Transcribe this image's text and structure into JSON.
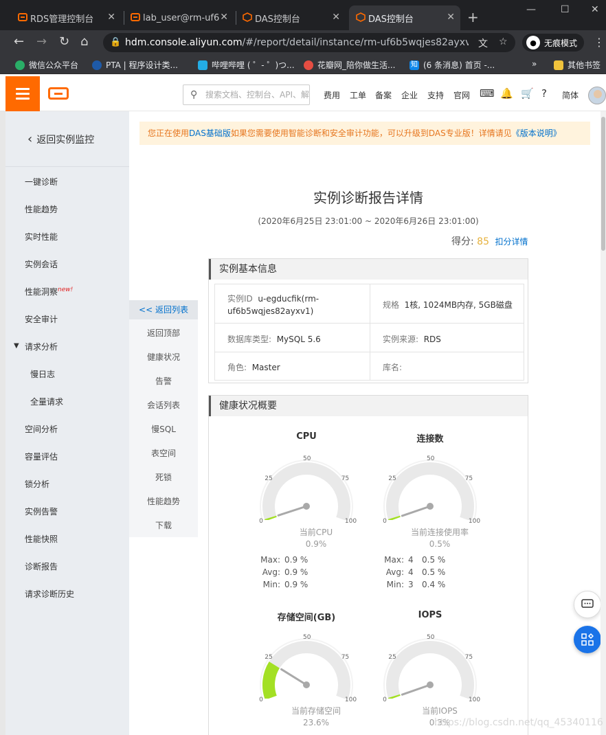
{
  "browser": {
    "tabs": [
      {
        "title": "RDS管理控制台"
      },
      {
        "title": "lab_user@rm-uf6"
      },
      {
        "title": "DAS控制台"
      },
      {
        "title": "DAS控制台"
      }
    ],
    "url_host": "hdm.console.aliyun.com",
    "url_path": "/#/report/detail/instance/rm-uf6b5wqjes82ayxv...",
    "incognito_label": "无痕模式",
    "bookmarks": [
      {
        "label": "微信公众平台"
      },
      {
        "label": "PTA | 程序设计类..."
      },
      {
        "label": "哔哩哔哩 ( ゜- ゜)つ..."
      },
      {
        "label": "花瓣网_陪你做生活..."
      },
      {
        "label": "(6 条消息) 首页 -..."
      }
    ],
    "other_bookmarks": "其他书签"
  },
  "topnav": {
    "search_placeholder": "搜索文档、控制台、API、解",
    "items": [
      "费用",
      "工单",
      "备案",
      "企业",
      "支持",
      "官网"
    ],
    "lang": "简体"
  },
  "sidebar": {
    "back_label": "返回实例监控",
    "items": [
      {
        "label": "一键诊断"
      },
      {
        "label": "性能趋势"
      },
      {
        "label": "实时性能"
      },
      {
        "label": "实例会话"
      },
      {
        "label": "性能洞察",
        "badge": "new!"
      },
      {
        "label": "安全审计"
      },
      {
        "label": "请求分析"
      },
      {
        "label": "慢日志"
      },
      {
        "label": "全量请求"
      },
      {
        "label": "空间分析"
      },
      {
        "label": "容量评估"
      },
      {
        "label": "锁分析"
      },
      {
        "label": "实例告警"
      },
      {
        "label": "性能快照"
      },
      {
        "label": "诊断报告"
      },
      {
        "label": "请求诊断历史"
      }
    ]
  },
  "anchor_nav": {
    "items": [
      "<< 返回列表",
      "返回顶部",
      "健康状况",
      "告警",
      "会话列表",
      "慢SQL",
      "表空间",
      "死锁",
      "性能趋势",
      "下载"
    ]
  },
  "notice": {
    "prefix": "您正在使用",
    "basic": "DAS基础版",
    "middle": "如果您需要使用智能诊断和安全审计功能，可以升级到DAS专业版！详情请见",
    "doc": "《版本说明》"
  },
  "report": {
    "title": "实例诊断报告详情",
    "range": "(2020年6月25日 23:01:00 ~ 2020年6月26日 23:01:00)",
    "score_label": "得分:",
    "score_value": "85",
    "score_detail": "扣分详情"
  },
  "instance_info": {
    "heading": "实例基本信息",
    "id_key": "实例ID",
    "id_val_1": "u-egducfik(rm-",
    "id_val_2": "uf6b5wqjes82ayxv1)",
    "spec_key": "规格",
    "spec_val": "1核, 1024MB内存, 5GB磁盘",
    "dbtype_key": "数据库类型:",
    "dbtype_val": "MySQL 5.6",
    "source_key": "实例来源:",
    "source_val": "RDS",
    "role_key": "角色:",
    "role_val": "Master",
    "dbname_key": "库名:",
    "dbname_val": ""
  },
  "health": {
    "heading": "健康状况概要",
    "gauges": [
      {
        "title": "CPU",
        "current_label": "当前CPU",
        "current": "0.9%",
        "value": 0.9,
        "max": "0.9 %",
        "avg": "0.9 %",
        "min": "0.9 %"
      },
      {
        "title": "连接数",
        "current_label": "当前连接使用率",
        "current": "0.5%",
        "value": 0.5,
        "max_n": "4",
        "avg_n": "4",
        "min_n": "3",
        "max": "0.5 %",
        "avg": "0.5 %",
        "min": "0.4 %"
      },
      {
        "title": "存储空间(GB)",
        "current_label": "当前存储空间",
        "current": "23.6%",
        "value": 23.6
      },
      {
        "title": "IOPS",
        "current_label": "当前IOPS",
        "current": "0.3%",
        "value": 0.3
      }
    ],
    "ticks": [
      "0",
      "25",
      "50",
      "75",
      "100"
    ],
    "stat_labels": {
      "max": "Max:",
      "avg": "Avg:",
      "min": "Min:"
    },
    "colors": {
      "track": "#e9e9e9",
      "fill": "#a3e024",
      "needle": "#a9a9a9"
    }
  },
  "watermark": "https://blog.csdn.net/qq_45340116"
}
